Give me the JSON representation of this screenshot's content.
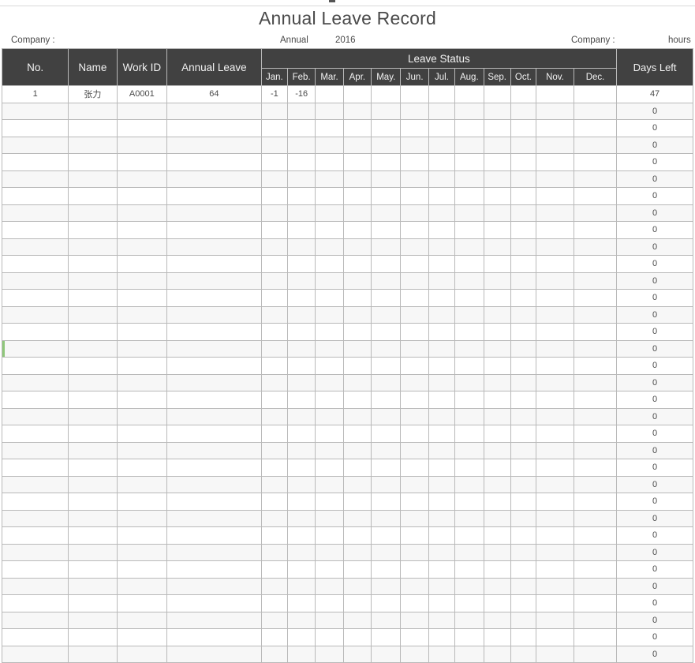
{
  "document": {
    "title": "Annual Leave Record",
    "meta": {
      "company_left_label": "Company :",
      "annual_label": "Annual",
      "year": "2016",
      "company_right_label": "Company :",
      "unit_label": "hours"
    }
  },
  "table": {
    "headers": {
      "no": "No.",
      "name": "Name",
      "work_id": "Work ID",
      "annual_leave": "Annual Leave",
      "leave_status": "Leave Status",
      "days_left": "Days Left",
      "months": [
        "Jan.",
        "Feb.",
        "Mar.",
        "Apr.",
        "May.",
        "Jun.",
        "Jul.",
        "Aug.",
        "Sep.",
        "Oct.",
        "Nov.",
        "Dec."
      ]
    },
    "rows": [
      {
        "no": "1",
        "name": "张力",
        "work_id": "A0001",
        "annual_leave": "64",
        "months": [
          "-1",
          "-16",
          "",
          "",
          "",
          "",
          "",
          "",
          "",
          "",
          "",
          ""
        ],
        "days_left": "47",
        "marked": false
      },
      {
        "no": "",
        "name": "",
        "work_id": "",
        "annual_leave": "",
        "months": [
          "",
          "",
          "",
          "",
          "",
          "",
          "",
          "",
          "",
          "",
          "",
          ""
        ],
        "days_left": "0",
        "marked": false
      },
      {
        "no": "",
        "name": "",
        "work_id": "",
        "annual_leave": "",
        "months": [
          "",
          "",
          "",
          "",
          "",
          "",
          "",
          "",
          "",
          "",
          "",
          ""
        ],
        "days_left": "0",
        "marked": false
      },
      {
        "no": "",
        "name": "",
        "work_id": "",
        "annual_leave": "",
        "months": [
          "",
          "",
          "",
          "",
          "",
          "",
          "",
          "",
          "",
          "",
          "",
          ""
        ],
        "days_left": "0",
        "marked": false
      },
      {
        "no": "",
        "name": "",
        "work_id": "",
        "annual_leave": "",
        "months": [
          "",
          "",
          "",
          "",
          "",
          "",
          "",
          "",
          "",
          "",
          "",
          ""
        ],
        "days_left": "0",
        "marked": false
      },
      {
        "no": "",
        "name": "",
        "work_id": "",
        "annual_leave": "",
        "months": [
          "",
          "",
          "",
          "",
          "",
          "",
          "",
          "",
          "",
          "",
          "",
          ""
        ],
        "days_left": "0",
        "marked": false
      },
      {
        "no": "",
        "name": "",
        "work_id": "",
        "annual_leave": "",
        "months": [
          "",
          "",
          "",
          "",
          "",
          "",
          "",
          "",
          "",
          "",
          "",
          ""
        ],
        "days_left": "0",
        "marked": false
      },
      {
        "no": "",
        "name": "",
        "work_id": "",
        "annual_leave": "",
        "months": [
          "",
          "",
          "",
          "",
          "",
          "",
          "",
          "",
          "",
          "",
          "",
          ""
        ],
        "days_left": "0",
        "marked": false
      },
      {
        "no": "",
        "name": "",
        "work_id": "",
        "annual_leave": "",
        "months": [
          "",
          "",
          "",
          "",
          "",
          "",
          "",
          "",
          "",
          "",
          "",
          ""
        ],
        "days_left": "0",
        "marked": false
      },
      {
        "no": "",
        "name": "",
        "work_id": "",
        "annual_leave": "",
        "months": [
          "",
          "",
          "",
          "",
          "",
          "",
          "",
          "",
          "",
          "",
          "",
          ""
        ],
        "days_left": "0",
        "marked": false
      },
      {
        "no": "",
        "name": "",
        "work_id": "",
        "annual_leave": "",
        "months": [
          "",
          "",
          "",
          "",
          "",
          "",
          "",
          "",
          "",
          "",
          "",
          ""
        ],
        "days_left": "0",
        "marked": false
      },
      {
        "no": "",
        "name": "",
        "work_id": "",
        "annual_leave": "",
        "months": [
          "",
          "",
          "",
          "",
          "",
          "",
          "",
          "",
          "",
          "",
          "",
          ""
        ],
        "days_left": "0",
        "marked": false
      },
      {
        "no": "",
        "name": "",
        "work_id": "",
        "annual_leave": "",
        "months": [
          "",
          "",
          "",
          "",
          "",
          "",
          "",
          "",
          "",
          "",
          "",
          ""
        ],
        "days_left": "0",
        "marked": false
      },
      {
        "no": "",
        "name": "",
        "work_id": "",
        "annual_leave": "",
        "months": [
          "",
          "",
          "",
          "",
          "",
          "",
          "",
          "",
          "",
          "",
          "",
          ""
        ],
        "days_left": "0",
        "marked": false
      },
      {
        "no": "",
        "name": "",
        "work_id": "",
        "annual_leave": "",
        "months": [
          "",
          "",
          "",
          "",
          "",
          "",
          "",
          "",
          "",
          "",
          "",
          ""
        ],
        "days_left": "0",
        "marked": false
      },
      {
        "no": "",
        "name": "",
        "work_id": "",
        "annual_leave": "",
        "months": [
          "",
          "",
          "",
          "",
          "",
          "",
          "",
          "",
          "",
          "",
          "",
          ""
        ],
        "days_left": "0",
        "marked": true
      },
      {
        "no": "",
        "name": "",
        "work_id": "",
        "annual_leave": "",
        "months": [
          "",
          "",
          "",
          "",
          "",
          "",
          "",
          "",
          "",
          "",
          "",
          ""
        ],
        "days_left": "0",
        "marked": false
      },
      {
        "no": "",
        "name": "",
        "work_id": "",
        "annual_leave": "",
        "months": [
          "",
          "",
          "",
          "",
          "",
          "",
          "",
          "",
          "",
          "",
          "",
          ""
        ],
        "days_left": "0",
        "marked": false
      },
      {
        "no": "",
        "name": "",
        "work_id": "",
        "annual_leave": "",
        "months": [
          "",
          "",
          "",
          "",
          "",
          "",
          "",
          "",
          "",
          "",
          "",
          ""
        ],
        "days_left": "0",
        "marked": false
      },
      {
        "no": "",
        "name": "",
        "work_id": "",
        "annual_leave": "",
        "months": [
          "",
          "",
          "",
          "",
          "",
          "",
          "",
          "",
          "",
          "",
          "",
          ""
        ],
        "days_left": "0",
        "marked": false
      },
      {
        "no": "",
        "name": "",
        "work_id": "",
        "annual_leave": "",
        "months": [
          "",
          "",
          "",
          "",
          "",
          "",
          "",
          "",
          "",
          "",
          "",
          ""
        ],
        "days_left": "0",
        "marked": false
      },
      {
        "no": "",
        "name": "",
        "work_id": "",
        "annual_leave": "",
        "months": [
          "",
          "",
          "",
          "",
          "",
          "",
          "",
          "",
          "",
          "",
          "",
          ""
        ],
        "days_left": "0",
        "marked": false
      },
      {
        "no": "",
        "name": "",
        "work_id": "",
        "annual_leave": "",
        "months": [
          "",
          "",
          "",
          "",
          "",
          "",
          "",
          "",
          "",
          "",
          "",
          ""
        ],
        "days_left": "0",
        "marked": false
      },
      {
        "no": "",
        "name": "",
        "work_id": "",
        "annual_leave": "",
        "months": [
          "",
          "",
          "",
          "",
          "",
          "",
          "",
          "",
          "",
          "",
          "",
          ""
        ],
        "days_left": "0",
        "marked": false
      },
      {
        "no": "",
        "name": "",
        "work_id": "",
        "annual_leave": "",
        "months": [
          "",
          "",
          "",
          "",
          "",
          "",
          "",
          "",
          "",
          "",
          "",
          ""
        ],
        "days_left": "0",
        "marked": false
      },
      {
        "no": "",
        "name": "",
        "work_id": "",
        "annual_leave": "",
        "months": [
          "",
          "",
          "",
          "",
          "",
          "",
          "",
          "",
          "",
          "",
          "",
          ""
        ],
        "days_left": "0",
        "marked": false
      },
      {
        "no": "",
        "name": "",
        "work_id": "",
        "annual_leave": "",
        "months": [
          "",
          "",
          "",
          "",
          "",
          "",
          "",
          "",
          "",
          "",
          "",
          ""
        ],
        "days_left": "0",
        "marked": false
      },
      {
        "no": "",
        "name": "",
        "work_id": "",
        "annual_leave": "",
        "months": [
          "",
          "",
          "",
          "",
          "",
          "",
          "",
          "",
          "",
          "",
          "",
          ""
        ],
        "days_left": "0",
        "marked": false
      },
      {
        "no": "",
        "name": "",
        "work_id": "",
        "annual_leave": "",
        "months": [
          "",
          "",
          "",
          "",
          "",
          "",
          "",
          "",
          "",
          "",
          "",
          ""
        ],
        "days_left": "0",
        "marked": false
      },
      {
        "no": "",
        "name": "",
        "work_id": "",
        "annual_leave": "",
        "months": [
          "",
          "",
          "",
          "",
          "",
          "",
          "",
          "",
          "",
          "",
          "",
          ""
        ],
        "days_left": "0",
        "marked": false
      },
      {
        "no": "",
        "name": "",
        "work_id": "",
        "annual_leave": "",
        "months": [
          "",
          "",
          "",
          "",
          "",
          "",
          "",
          "",
          "",
          "",
          "",
          ""
        ],
        "days_left": "0",
        "marked": false
      },
      {
        "no": "",
        "name": "",
        "work_id": "",
        "annual_leave": "",
        "months": [
          "",
          "",
          "",
          "",
          "",
          "",
          "",
          "",
          "",
          "",
          "",
          ""
        ],
        "days_left": "0",
        "marked": false
      },
      {
        "no": "",
        "name": "",
        "work_id": "",
        "annual_leave": "",
        "months": [
          "",
          "",
          "",
          "",
          "",
          "",
          "",
          "",
          "",
          "",
          "",
          ""
        ],
        "days_left": "0",
        "marked": false
      },
      {
        "no": "",
        "name": "",
        "work_id": "",
        "annual_leave": "",
        "months": [
          "",
          "",
          "",
          "",
          "",
          "",
          "",
          "",
          "",
          "",
          "",
          ""
        ],
        "days_left": "0",
        "marked": false
      }
    ]
  },
  "colors": {
    "header_bg": "#414141",
    "header_text": "#f2f2f2",
    "title_text": "#4a4a4a",
    "grid_line": "#b9b9b9",
    "row_alt_bg": "#f7f7f7",
    "marker_green": "#8fc77a"
  }
}
